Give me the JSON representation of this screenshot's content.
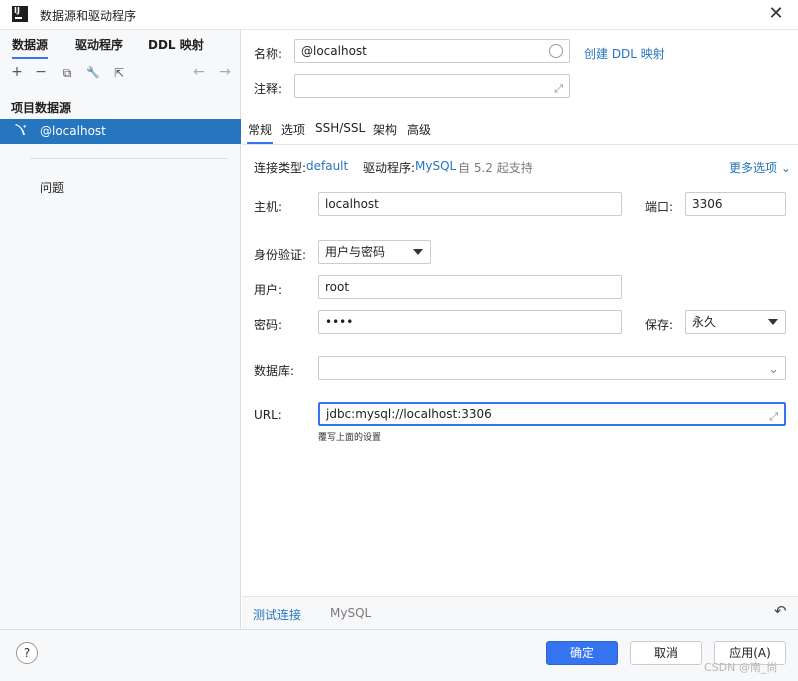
{
  "window": {
    "title": "数据源和驱动程序",
    "close_glyph": "✕"
  },
  "left": {
    "tabs": [
      "数据源",
      "驱动程序",
      "DDL 映射"
    ],
    "toolbar": {
      "add": "+",
      "remove": "−",
      "copy": "⧉",
      "settings": "🔧",
      "export": "⇱",
      "back": "←",
      "forward": "→"
    },
    "project_heading": "项目数据源",
    "datasource_item": "@localhost",
    "problems_label": "问题"
  },
  "form": {
    "name_label": "名称:",
    "name_value": "@localhost",
    "create_ddl_link": "创建 DDL 映射",
    "comment_label": "注释:",
    "comment_value": "",
    "tabs": [
      "常规",
      "选项",
      "SSH/SSL",
      "架构",
      "高级"
    ],
    "conn_type_label": "连接类型:",
    "conn_type_value": "default",
    "driver_label": "驱动程序:",
    "driver_value": "MySQL",
    "driver_note": "自 5.2 起支持",
    "more_options": "更多选项",
    "host_label": "主机:",
    "host_value": "localhost",
    "port_label": "端口:",
    "port_value": "3306",
    "auth_label": "身份验证:",
    "auth_value": "用户与密码",
    "user_label": "用户:",
    "user_value": "root",
    "password_label": "密码:",
    "password_value": "••••",
    "save_label": "保存:",
    "save_value": "永久",
    "database_label": "数据库:",
    "database_value": "",
    "url_label": "URL:",
    "url_value": "jdbc:mysql://localhost:3306",
    "url_hint": "覆写上面的设置"
  },
  "bottom": {
    "test_connection": "测试连接",
    "driver_name": "MySQL",
    "reset_glyph": "↶"
  },
  "footer": {
    "help": "?",
    "ok": "确定",
    "cancel": "取消",
    "apply": "应用(A)",
    "watermark": "CSDN @南_尚"
  }
}
